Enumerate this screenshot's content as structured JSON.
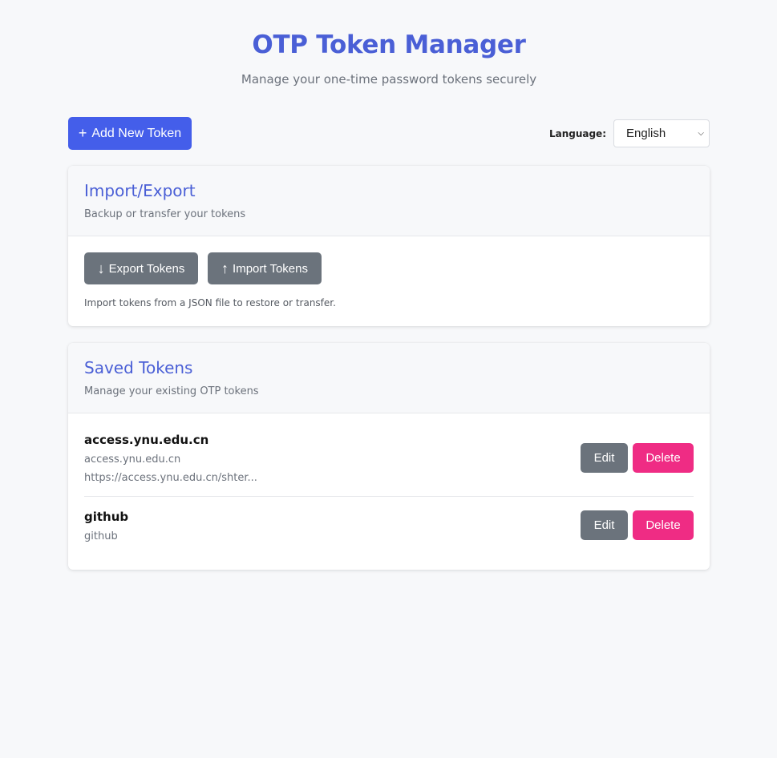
{
  "header": {
    "title": "OTP Token Manager",
    "subtitle": "Manage your one-time password tokens securely"
  },
  "toolbar": {
    "add_icon": "plus-icon",
    "add_label": "Add New Token",
    "language_label": "Language:",
    "language_selected": "English"
  },
  "import_export": {
    "title": "Import/Export",
    "description": "Backup or transfer your tokens",
    "export_icon": "arrow-down-icon",
    "export_label": "Export Tokens",
    "import_icon": "arrow-up-icon",
    "import_label": "Import Tokens",
    "note": "Import tokens from a JSON file to restore or transfer."
  },
  "saved_tokens": {
    "title": "Saved Tokens",
    "description": "Manage your existing OTP tokens",
    "edit_label": "Edit",
    "delete_label": "Delete",
    "items": [
      {
        "name": "access.ynu.edu.cn",
        "issuer": "access.ynu.edu.cn",
        "url": "https://access.ynu.edu.cn/shter..."
      },
      {
        "name": "github",
        "issuer": "github"
      }
    ]
  },
  "colors": {
    "accent": "#445eea",
    "title": "#4a5fd6",
    "secondary_button": "#6b737c",
    "danger_button": "#ef2c84",
    "background": "#f7f8fa"
  }
}
